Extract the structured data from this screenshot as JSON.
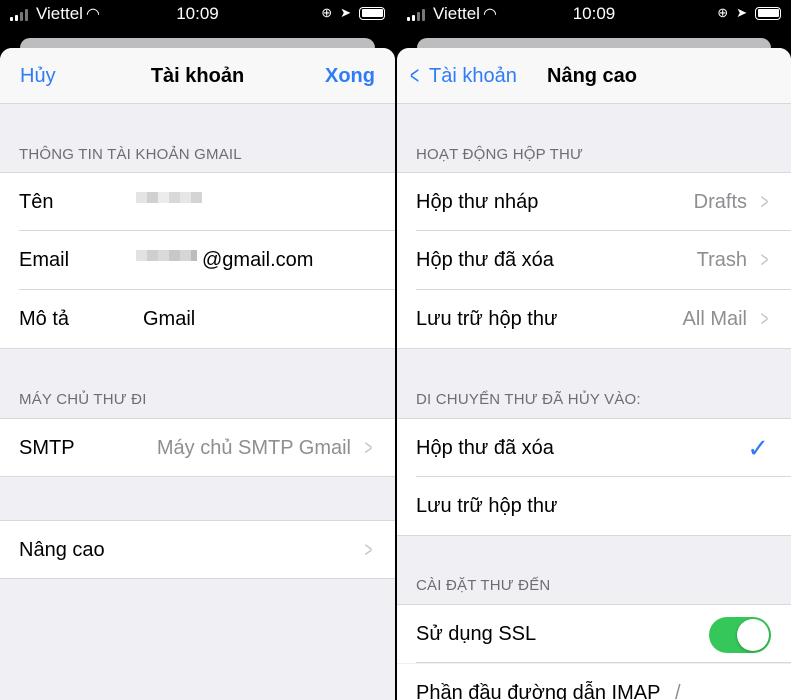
{
  "status_bar": {
    "carrier": "Viettel",
    "time": "10:09"
  },
  "left": {
    "nav": {
      "cancel": "Hủy",
      "title": "Tài khoản",
      "done": "Xong"
    },
    "section_account": "THÔNG TIN TÀI KHOẢN GMAIL",
    "rows": [
      {
        "label": "Tên",
        "value": ""
      },
      {
        "label": "Email",
        "value": "@gmail.com"
      },
      {
        "label": "Mô tả",
        "value": "Gmail"
      }
    ],
    "section_outgoing": "MÁY CHỦ THƯ ĐI",
    "smtp": {
      "label": "SMTP",
      "value": "Máy chủ SMTP Gmail"
    },
    "advanced": {
      "label": "Nâng cao"
    }
  },
  "right": {
    "nav": {
      "back": "Tài khoản",
      "title": "Nâng cao"
    },
    "section_mailbox": "HOẠT ĐỘNG HỘP THƯ",
    "mailbox_rows": [
      {
        "label": "Hộp thư nháp",
        "value": "Drafts"
      },
      {
        "label": "Hộp thư đã xóa",
        "value": "Trash"
      },
      {
        "label": "Lưu trữ hộp thư",
        "value": "All Mail"
      }
    ],
    "section_move": "DI CHUYỂN THƯ ĐÃ HỦY VÀO:",
    "move_options": [
      {
        "label": "Hộp thư đã xóa",
        "selected": true
      },
      {
        "label": "Lưu trữ hộp thư",
        "selected": false
      }
    ],
    "section_incoming": "CÀI ĐẶT THƯ ĐẾN",
    "ssl": {
      "label": "Sử dụng SSL",
      "on": true
    },
    "imap_prefix": {
      "label": "Phần đầu đường dẫn IMAP",
      "value": "/"
    }
  },
  "colors": {
    "accent": "#2f7cf6",
    "toggle_on": "#35c759"
  }
}
